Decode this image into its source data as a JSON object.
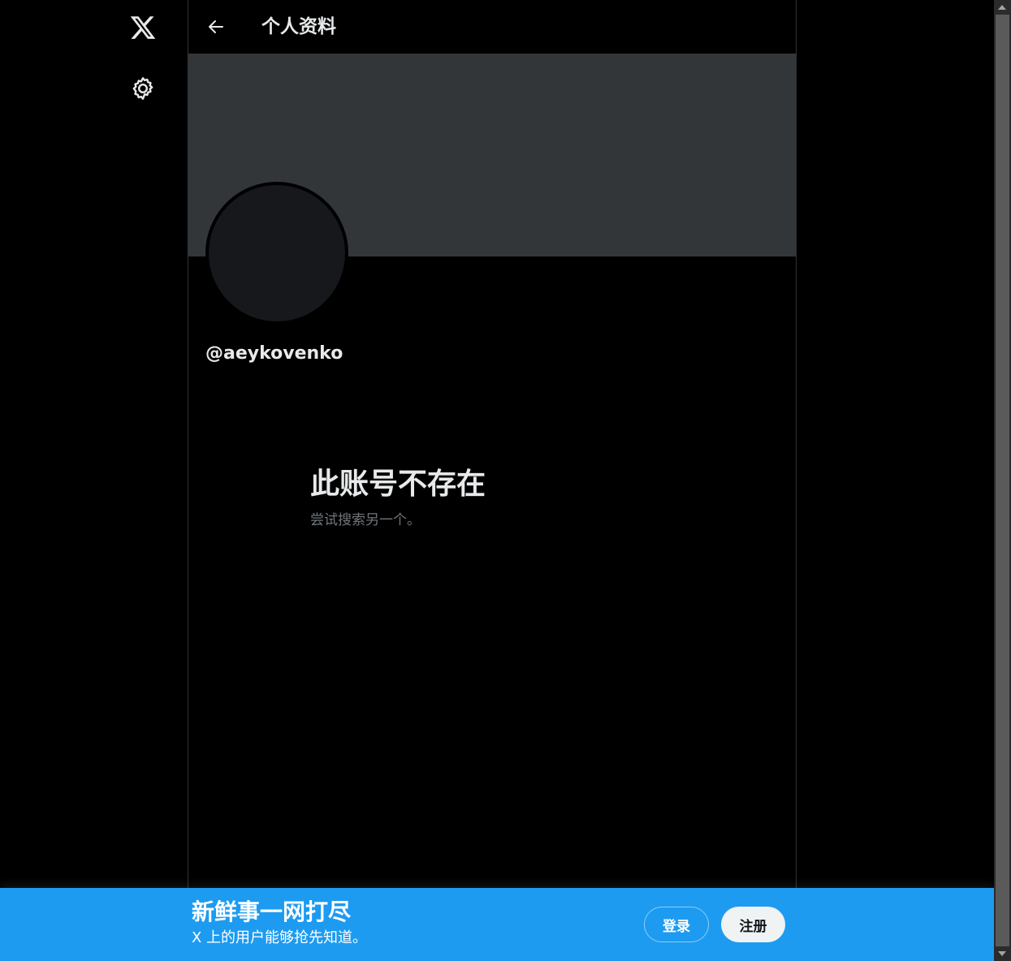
{
  "header": {
    "title": "个人资料"
  },
  "profile": {
    "handle": "@aeykovenko"
  },
  "empty_state": {
    "title": "此账号不存在",
    "subtitle": "尝试搜索另一个。"
  },
  "bottom_bar": {
    "title": "新鲜事一网打尽",
    "subtitle": "X 上的用户能够抢先知道。",
    "login_label": "登录",
    "signup_label": "注册"
  },
  "colors": {
    "background": "#000000",
    "banner": "#333639",
    "avatar": "#16181c",
    "accent": "#1d9bf0",
    "subtitle_text": "#71767b"
  },
  "icons": [
    "x-logo-icon",
    "settings-icon",
    "back-arrow-icon"
  ]
}
